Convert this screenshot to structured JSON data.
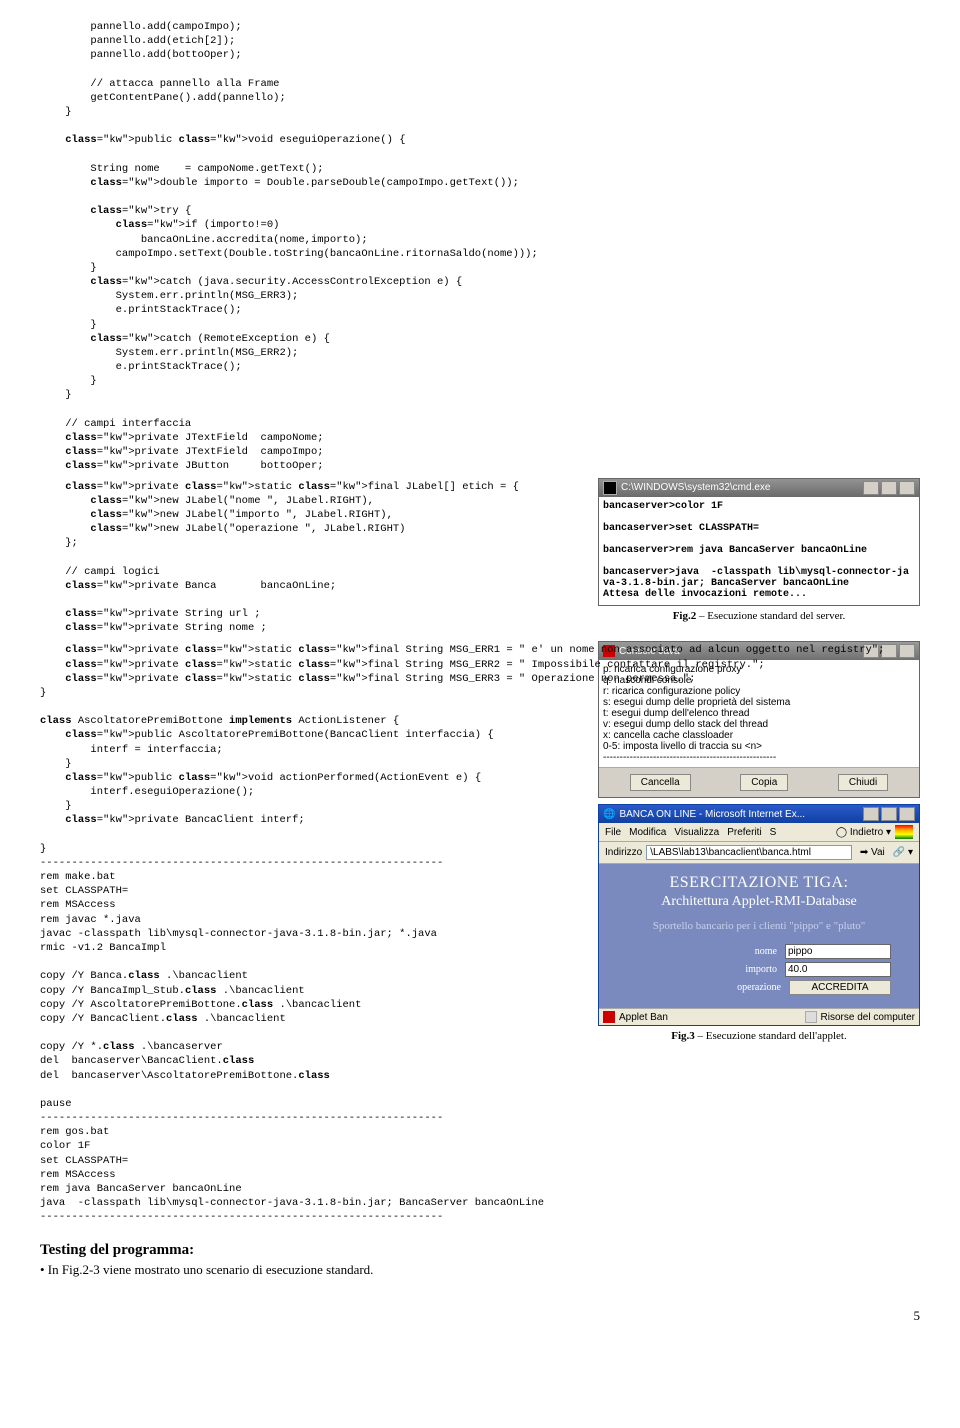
{
  "code_top": "        pannello.add(campoImpo);\n        pannello.add(etich[2]);\n        pannello.add(bottoOper);\n\n        // attacca pannello alla Frame\n        getContentPane().add(pannello);\n    }\n\n    public void eseguiOperazione() {\n\n        String nome    = campoNome.getText();\n        double importo = Double.parseDouble(campoImpo.getText());\n\n        try {\n            if (importo!=0)\n                bancaOnLine.accredita(nome,importo);\n            campoImpo.setText(Double.toString(bancaOnLine.ritornaSaldo(nome)));\n        }\n        catch (java.security.AccessControlException e) {\n            System.err.println(MSG_ERR3);\n            e.printStackTrace();\n        }\n        catch (RemoteException e) {\n            System.err.println(MSG_ERR2);\n            e.printStackTrace();\n        }\n    }\n\n    // campi interfaccia\n    private JTextField  campoNome;\n    private JTextField  campoImpo;\n    private JButton     bottoOper;",
  "code_etich": "    private static final JLabel[] etich = {\n        new JLabel(\"nome \", JLabel.RIGHT),\n        new JLabel(\"importo \", JLabel.RIGHT),\n        new JLabel(\"operazione \", JLabel.RIGHT)\n    };\n\n    // campi logici\n    private Banca       bancaOnLine;\n\n    private String url ;\n    private String nome ;",
  "code_msgs": "    private static final String MSG_ERR1 = \" e' un nome non associato ad alcun oggetto nel registry\";\n    private static final String MSG_ERR2 = \" Impossibile contattare il registry.\";\n    private static final String MSG_ERR3 = \" Operazione non permessa.\";\n}\n\nclass AscoltatorePremiBottone implements ActionListener {\n    public AscoltatorePremiBottone(BancaClient interfaccia) {\n        interf = interfaccia;\n    }\n    public void actionPerformed(ActionEvent e) {\n        interf.eseguiOperazione();\n    }\n    private BancaClient interf;\n\n}\n----------------------------------------------------------------\nrem make.bat\nset CLASSPATH=\nrem MSAccess\nrem javac *.java\njavac -classpath lib\\mysql-connector-java-3.1.8-bin.jar; *.java\nrmic -v1.2 BancaImpl\n\ncopy /Y Banca.class .\\bancaclient\ncopy /Y BancaImpl_Stub.class .\\bancaclient\ncopy /Y AscoltatorePremiBottone.class .\\bancaclient\ncopy /Y BancaClient.class .\\bancaclient\n\ncopy /Y *.class .\\bancaserver\ndel  bancaserver\\BancaClient.class\ndel  bancaserver\\AscoltatorePremiBottone.class\n\npause\n----------------------------------------------------------------\nrem gos.bat\ncolor 1F\nset CLASSPATH=\nrem MSAccess\nrem java BancaServer bancaOnLine\njava  -classpath lib\\mysql-connector-java-3.1.8-bin.jar; BancaServer bancaOnLine\n----------------------------------------------------------------",
  "cmd": {
    "title": "C:\\WINDOWS\\system32\\cmd.exe",
    "lines": "bancaserver>color 1F\n\nbancaserver>set CLASSPATH=\n\nbancaserver>rem java BancaServer bancaOnLine\n\nbancaserver>java  -classpath lib\\mysql-connector-ja\nva-3.1.8-bin.jar; BancaServer bancaOnLine\nAttesa delle invocazioni remote..."
  },
  "fig2_label": "Fig.2",
  "fig2_text": " – Esecuzione standard del server.",
  "console": {
    "title": "Console Java",
    "items": "p:  ricarica configurazione proxy\nq:  nascondi console\nr:  ricarica configurazione policy\ns:  esegui dump delle proprietà del sistema\nt:  esegui dump dell'elenco thread\nv:  esegui dump dello stack del thread\nx:  cancella cache classloader\n0-5: imposta livello di traccia su <n>\n----------------------------------------------------",
    "btn_cancel": "Cancella",
    "btn_copy": "Copia",
    "btn_close": "Chiudi"
  },
  "ie": {
    "title": "BANCA ON LINE - Microsoft Internet Ex...",
    "menu_file": "File",
    "menu_modifica": "Modifica",
    "menu_visualizza": "Visualizza",
    "menu_preferiti": "Preferiti",
    "menu_s": "S",
    "back": "Indietro",
    "addr_label": "Indirizzo",
    "addr_value": "\\LABS\\lab13\\bancaclient\\banca.html",
    "vai": "Vai",
    "applet_h2": "ESERCITAZIONE TIGA:",
    "applet_h3": "Architettura Applet-RMI-Database",
    "applet_sub": "Sportello bancario per i clienti \"pippo\" e \"pluto\"",
    "lbl_nome": "nome",
    "val_nome": "pippo",
    "lbl_importo": "importo",
    "val_importo": "40.0",
    "lbl_oper": "operazione",
    "btn_accr": "ACCREDITA",
    "status_left": "Applet Ban",
    "status_right": "Risorse del computer"
  },
  "fig3_label": "Fig.3",
  "fig3_text": " – Esecuzione standard dell'applet.",
  "testing_title": "Testing del programma:",
  "testing_body": "• In Fig.2-3 viene mostrato uno scenario di esecuzione standard.",
  "page_number": "5"
}
